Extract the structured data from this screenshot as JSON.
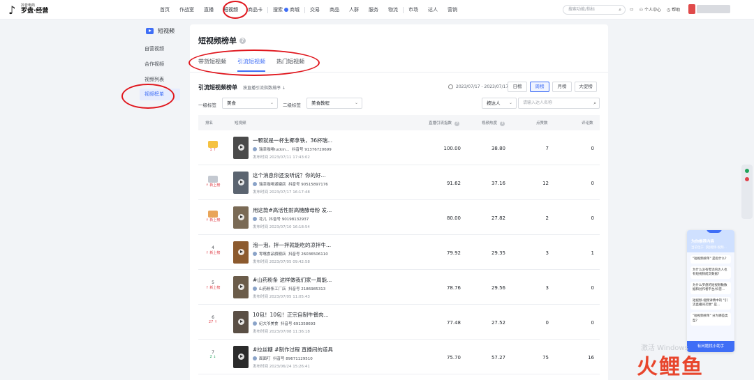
{
  "header": {
    "logo_small": "抖音电商",
    "logo_big": "罗盘·经营",
    "nav": [
      {
        "label": "首页"
      },
      {
        "label": "作战室"
      },
      {
        "label": "直播"
      },
      {
        "label": "短视频"
      },
      {
        "label": "商品卡"
      },
      {
        "label": "搜索"
      },
      {
        "label": "商城"
      },
      {
        "label": "交易"
      },
      {
        "label": "商品"
      },
      {
        "label": "人群"
      },
      {
        "label": "服务"
      },
      {
        "label": "物流"
      },
      {
        "label": "市场"
      },
      {
        "label": "达人"
      },
      {
        "label": "营销"
      }
    ],
    "search_placeholder": "搜索功能/指标",
    "personal_center": "个人中心",
    "help_label": "帮助"
  },
  "sidebar": {
    "title": "短视频",
    "items": [
      {
        "label": "自营视频"
      },
      {
        "label": "合作视频"
      },
      {
        "label": "视频列表"
      },
      {
        "label": "视频榜单"
      }
    ]
  },
  "main": {
    "title": "短视频榜单",
    "tabs": [
      {
        "label": "带货短视频"
      },
      {
        "label": "引流短视频"
      },
      {
        "label": "热门短视频"
      }
    ],
    "section_title": "引流短视频榜单",
    "sort_hint": "按直播引流指数排序 ↓",
    "date_range": "2023/07/17 - 2023/07/17",
    "periods": [
      {
        "label": "日榜"
      },
      {
        "label": "周榜"
      },
      {
        "label": "月榜"
      },
      {
        "label": "大促榜"
      }
    ],
    "filter1_label": "一级标签",
    "filter1_value": "美食",
    "filter2_label": "二级标签",
    "filter2_value": "美食教程",
    "search_type": "按达人",
    "search_placeholder": "请输入达人名称",
    "columns": {
      "rank": "排名",
      "video": "短视频",
      "traffic": "直播引流指数",
      "heat": "视频热度",
      "likes": "点赞数",
      "comments": "评论数"
    }
  },
  "rows": [
    {
      "rank": "1",
      "change": "1 ↑",
      "title": "一颗就是一杯生椰拿铁，36杯瑞...",
      "author": "瑞幸咖啡luckin...",
      "douyin_id": "抖音号 91376720699",
      "time": "发布时间 2023/07/11 17:43:02",
      "traffic": "100.00",
      "heat": "38.80",
      "likes": "7",
      "comments": "0"
    },
    {
      "rank": "2",
      "change": "↑ 新上榜",
      "title": "这个消息你还没听说？你的好...",
      "author": "瑞幸咖啡湖塘店",
      "douyin_id": "抖音号 90515897176",
      "time": "发布时间 2023/07/17 16:17:48",
      "traffic": "91.62",
      "heat": "37.16",
      "likes": "12",
      "comments": "0"
    },
    {
      "rank": "3",
      "change": "↑ 新上榜",
      "title": "用这款#高活性耐高糖酵母粉 发...",
      "author": "花儿",
      "douyin_id": "抖音号 90198132937",
      "time": "发布时间 2023/07/10 16:18:54",
      "traffic": "80.00",
      "heat": "27.82",
      "likes": "2",
      "comments": "0"
    },
    {
      "rank": "4",
      "change": "↑ 新上榜",
      "title": "泡一泡，拌一拌就能吃的凉拌牛...",
      "author": "零嘴食品旗舰店",
      "douyin_id": "抖音号 26036506110",
      "time": "发布时间 2023/07/05 09:42:58",
      "traffic": "79.92",
      "heat": "29.35",
      "likes": "3",
      "comments": "1"
    },
    {
      "rank": "5",
      "change": "↑ 新上榜",
      "title": "#山药粉条 这样做我们家一周能...",
      "author": "山药粉条工厂店",
      "douyin_id": "抖音号 2186985313",
      "time": "发布时间 2023/07/05 11:05:43",
      "traffic": "78.76",
      "heat": "29.56",
      "likes": "3",
      "comments": "0"
    },
    {
      "rank": "6",
      "change": "27 ↑",
      "title": "10包！10包！正宗自制牛餐肉...",
      "author": "纪大爷美食",
      "douyin_id": "抖音号 691358693",
      "time": "发布时间 2023/07/08 11:36:18",
      "traffic": "77.48",
      "heat": "27.52",
      "likes": "0",
      "comments": "0"
    },
    {
      "rank": "7",
      "change": "2 ↓",
      "title": "#拉丝糖 #制作过程 直播间的道具",
      "author": "面面叮",
      "douyin_id": "抖音号 89671129510",
      "time": "发布时间 2023/06/24 15:26:41",
      "traffic": "75.70",
      "heat": "57.27",
      "likes": "75",
      "comments": "16"
    }
  ],
  "assistant": {
    "title": "为你推荐内容",
    "subtitle": "当前位于【短视频-视频...",
    "questions": [
      "\"短视频榜单\" 是指什么?",
      "为什么没有零流的达人也有短视频成交数据?",
      "为什么罗盘的短视频数数据和创作者平台/抖音...",
      "短视频-视频详情中的 \"引流直播间次数\" 是...",
      "\"短视频榜单\" 分为哪些类型?"
    ],
    "button": "有问题找小助手"
  },
  "watermarks": {
    "windows": "激活 Windows",
    "brand": "火鲤鱼"
  },
  "colors": {
    "accent": "#3f6ef6",
    "annotation": "#e0161d",
    "up": "#e0404a",
    "down": "#21a35b"
  }
}
